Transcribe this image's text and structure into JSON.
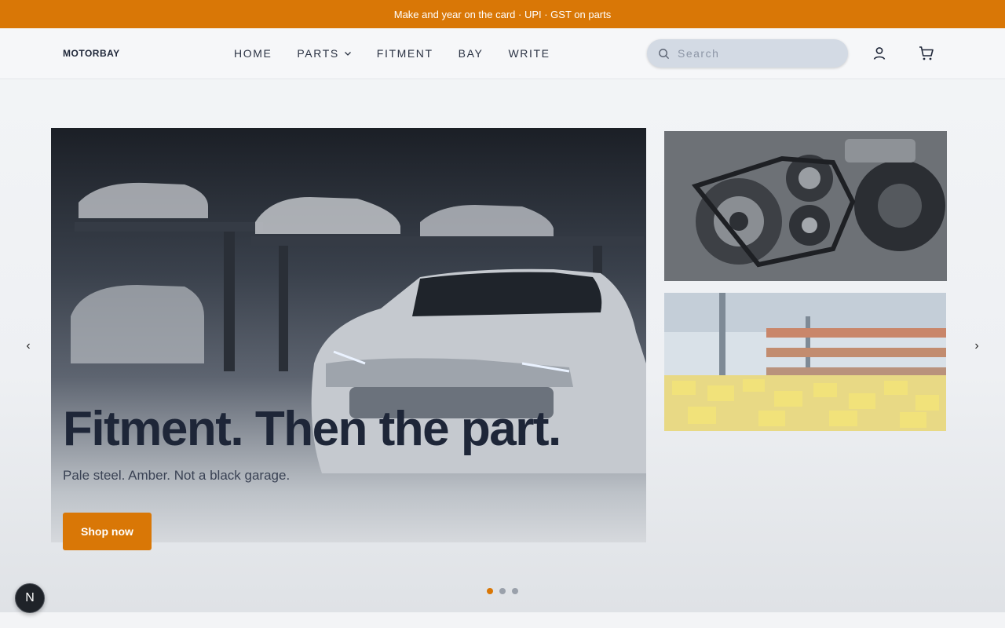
{
  "announcement": "Make and year on the card · UPI · GST on parts",
  "brand": "MOTORBAY",
  "nav": {
    "home": "HOME",
    "parts": "PARTS",
    "fitment": "FITMENT",
    "bay": "BAY",
    "write": "WRITE"
  },
  "search": {
    "placeholder": "Search",
    "value": ""
  },
  "icons": {
    "search": "search-icon",
    "account": "user-icon",
    "cart": "cart-icon",
    "parts_menu": "chevron-down-icon"
  },
  "hero": {
    "title": "Fitment. Then the part.",
    "subtitle": "Pale steel. Amber. Not a black garage.",
    "cta_label": "Shop now",
    "prev": "‹",
    "next": "›",
    "slides_total": 3,
    "active_slide": 1
  },
  "dev_badge": "N",
  "colors": {
    "accent": "#d97706",
    "text": "#1e2638",
    "background": "#f2f4f6"
  }
}
